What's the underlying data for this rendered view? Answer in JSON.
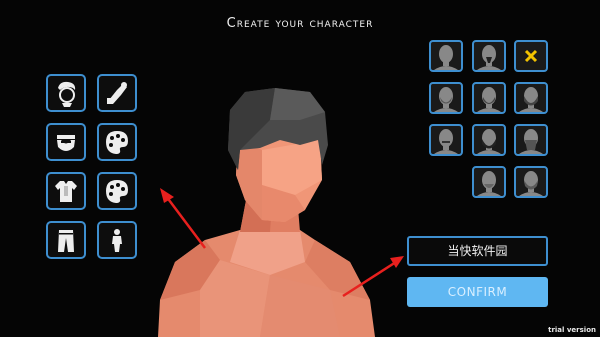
{
  "screen": {
    "title": "Create your character"
  },
  "left_panel": {
    "slots": [
      {
        "icon": "head-icon"
      },
      {
        "icon": "arm-icon"
      },
      {
        "icon": "beard-icon",
        "selected": true
      },
      {
        "icon": "palette-icon"
      },
      {
        "icon": "shirt-icon"
      },
      {
        "icon": "palette-icon"
      },
      {
        "icon": "pants-icon"
      },
      {
        "icon": "body-icon"
      }
    ]
  },
  "right_panel": {
    "options": [
      {
        "icon": "bald-head-icon"
      },
      {
        "icon": "goatee-head-icon"
      },
      {
        "icon": "remove-x-icon"
      },
      {
        "icon": "stubble-head-icon"
      },
      {
        "icon": "short-beard-head-icon"
      },
      {
        "icon": "full-beard-head-icon"
      },
      {
        "icon": "moustache-head-icon"
      },
      {
        "icon": "thick-beard-head-icon"
      },
      {
        "icon": "long-beard-head-icon"
      },
      {
        "icon": "chin-beard-head-icon"
      },
      {
        "icon": "big-beard-head-icon"
      }
    ]
  },
  "buttons": {
    "name_label": "当快软件园",
    "confirm_label": "CONFIRM"
  },
  "watermark": "trial version",
  "colors": {
    "accent": "#3e8fd0",
    "confirm": "#5fb7f2",
    "skin": "#e8876a",
    "hair": "#4a4a4a",
    "arrow": "#e8201e"
  }
}
